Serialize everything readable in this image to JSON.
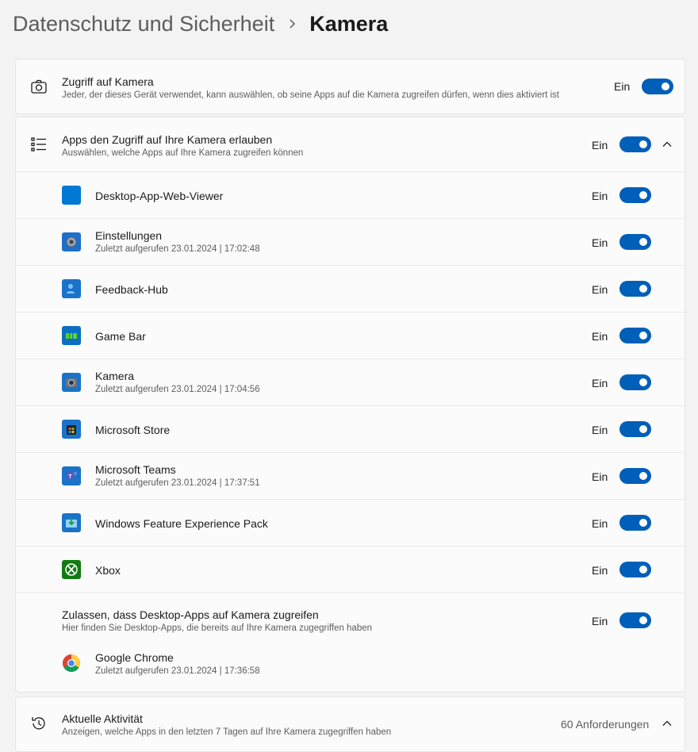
{
  "breadcrumb": {
    "parent": "Datenschutz und Sicherheit",
    "current": "Kamera"
  },
  "camera_access": {
    "title": "Zugriff auf Kamera",
    "subtitle": "Jeder, der dieses Gerät verwendet, kann auswählen, ob seine Apps auf die Kamera zugreifen dürfen, wenn dies aktiviert ist",
    "state": "Ein"
  },
  "apps_access": {
    "title": "Apps den Zugriff auf Ihre Kamera erlauben",
    "subtitle": "Auswählen, welche Apps auf Ihre Kamera zugreifen können",
    "state": "Ein"
  },
  "apps": [
    {
      "name": "Desktop-App-Web-Viewer",
      "last_used": "",
      "state": "Ein",
      "icon": "web-viewer-icon"
    },
    {
      "name": "Einstellungen",
      "last_used": "Zuletzt aufgerufen 23.01.2024  |  17:02:48",
      "state": "Ein",
      "icon": "settings-gear-icon"
    },
    {
      "name": "Feedback-Hub",
      "last_used": "",
      "state": "Ein",
      "icon": "feedback-hub-icon"
    },
    {
      "name": "Game Bar",
      "last_used": "",
      "state": "Ein",
      "icon": "game-bar-icon"
    },
    {
      "name": "Kamera",
      "last_used": "Zuletzt aufgerufen 23.01.2024  |  17:04:56",
      "state": "Ein",
      "icon": "camera-app-icon"
    },
    {
      "name": "Microsoft Store",
      "last_used": "",
      "state": "Ein",
      "icon": "store-icon"
    },
    {
      "name": "Microsoft Teams",
      "last_used": "Zuletzt aufgerufen 23.01.2024  |  17:37:51",
      "state": "Ein",
      "icon": "teams-icon"
    },
    {
      "name": "Windows Feature Experience Pack",
      "last_used": "",
      "state": "Ein",
      "icon": "feature-pack-icon"
    },
    {
      "name": "Xbox",
      "last_used": "",
      "state": "Ein",
      "icon": "xbox-icon"
    }
  ],
  "desktop_apps": {
    "title": "Zulassen, dass Desktop-Apps auf Kamera zugreifen",
    "subtitle": "Hier finden Sie Desktop-Apps, die bereits auf Ihre Kamera zugegriffen haben",
    "state": "Ein",
    "chrome": {
      "name": "Google Chrome",
      "last_used": "Zuletzt aufgerufen 23.01.2024  |  17:36:58"
    }
  },
  "recent_activity": {
    "title": "Aktuelle Aktivität",
    "subtitle": "Anzeigen, welche Apps in den letzten 7 Tagen auf Ihre Kamera zugegriffen haben",
    "count": "60 Anforderungen"
  },
  "colors": {
    "accent": "#005fb8",
    "background": "#f3f3f3",
    "card": "#fbfbfb"
  }
}
